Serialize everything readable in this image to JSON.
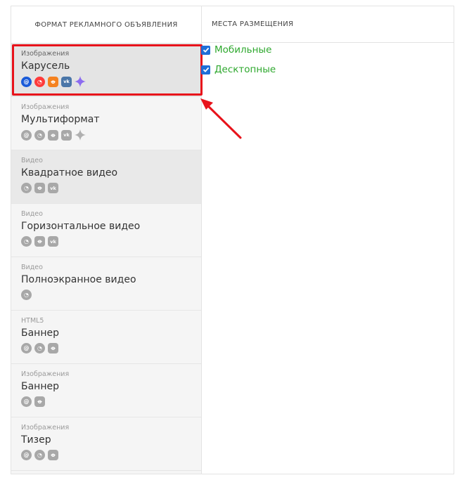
{
  "headers": {
    "format": "ФОРМАТ РЕКЛАМНОГО ОБЪЯВЛЕНИЯ",
    "placements": "МЕСТА РАЗМЕЩЕНИЯ"
  },
  "formats": [
    {
      "category": "Изображения",
      "name": "Карусель",
      "selected": true,
      "icons": [
        "mail-icon",
        "mytarget-icon",
        "odnoklassniki-icon",
        "vk-icon",
        "sparkle-icon"
      ]
    },
    {
      "category": "Изображения",
      "name": "Мультиформат",
      "icons": [
        "mail-icon",
        "mytarget-icon",
        "odnoklassniki-icon",
        "vk-icon",
        "sparkle-icon"
      ]
    },
    {
      "category": "Видео",
      "name": "Квадратное видео",
      "icons": [
        "mytarget-icon",
        "odnoklassniki-icon",
        "vk-icon"
      ]
    },
    {
      "category": "Видео",
      "name": "Горизонтальное видео",
      "icons": [
        "mytarget-icon",
        "odnoklassniki-icon",
        "vk-icon"
      ]
    },
    {
      "category": "Видео",
      "name": "Полноэкранное видео",
      "icons": [
        "mytarget-icon"
      ]
    },
    {
      "category": "HTML5",
      "name": "Баннер",
      "icons": [
        "mail-icon",
        "mytarget-icon",
        "odnoklassniki-icon"
      ]
    },
    {
      "category": "Изображения",
      "name": "Баннер",
      "icons": [
        "mail-icon",
        "odnoklassniki-icon"
      ]
    },
    {
      "category": "Изображения",
      "name": "Тизер",
      "icons": [
        "mail-icon",
        "mytarget-icon",
        "odnoklassniki-icon"
      ]
    }
  ],
  "placements": [
    {
      "label": "Мобильные",
      "checked": true
    },
    {
      "label": "Десктопные",
      "checked": true
    }
  ],
  "colors": {
    "selection_outline": "#e8131b",
    "placement_text": "#2ea82e",
    "checkbox": "#1e6fd8"
  }
}
